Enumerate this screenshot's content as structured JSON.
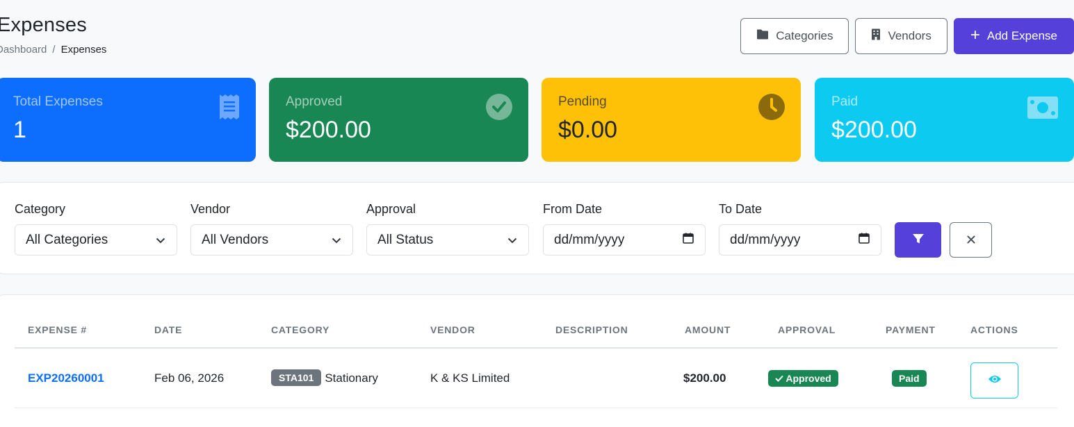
{
  "header": {
    "title": "Expenses",
    "breadcrumb": [
      "Dashboard",
      "Expenses"
    ],
    "breadcrumb_separator": "/"
  },
  "actions": {
    "categories": "Categories",
    "vendors": "Vendors",
    "add_expense": "Add Expense"
  },
  "stats": [
    {
      "label": "Total Expenses",
      "value": "1",
      "icon": "receipt-icon",
      "color": "#0d6efd"
    },
    {
      "label": "Approved",
      "value": "$200.00",
      "icon": "check-circle-icon",
      "color": "#198754"
    },
    {
      "label": "Pending",
      "value": "$0.00",
      "icon": "clock-icon",
      "color": "#ffc107"
    },
    {
      "label": "Paid",
      "value": "$200.00",
      "icon": "cash-icon",
      "color": "#0dcaf0"
    }
  ],
  "filters": {
    "category": {
      "label": "Category",
      "value": "All Categories"
    },
    "vendor": {
      "label": "Vendor",
      "value": "All Vendors"
    },
    "approval": {
      "label": "Approval",
      "value": "All Status"
    },
    "from_date": {
      "label": "From Date",
      "placeholder": "dd/mm/yyyy"
    },
    "to_date": {
      "label": "To Date",
      "placeholder": "dd/mm/yyyy"
    }
  },
  "table": {
    "columns": [
      "EXPENSE #",
      "DATE",
      "CATEGORY",
      "VENDOR",
      "DESCRIPTION",
      "AMOUNT",
      "APPROVAL",
      "PAYMENT",
      "ACTIONS"
    ],
    "rows": [
      {
        "expense_no": "EXP20260001",
        "date": "Feb 06, 2026",
        "category_code": "STA101",
        "category_name": "Stationary",
        "vendor": "K & KS Limited",
        "description": "",
        "amount": "$200.00",
        "approval": "Approved",
        "payment": "Paid"
      }
    ]
  },
  "colors": {
    "primary": "#5541d9",
    "link": "#0d6efd",
    "success": "#198754",
    "info": "#0dcaf0",
    "secondary": "#6c757d"
  }
}
